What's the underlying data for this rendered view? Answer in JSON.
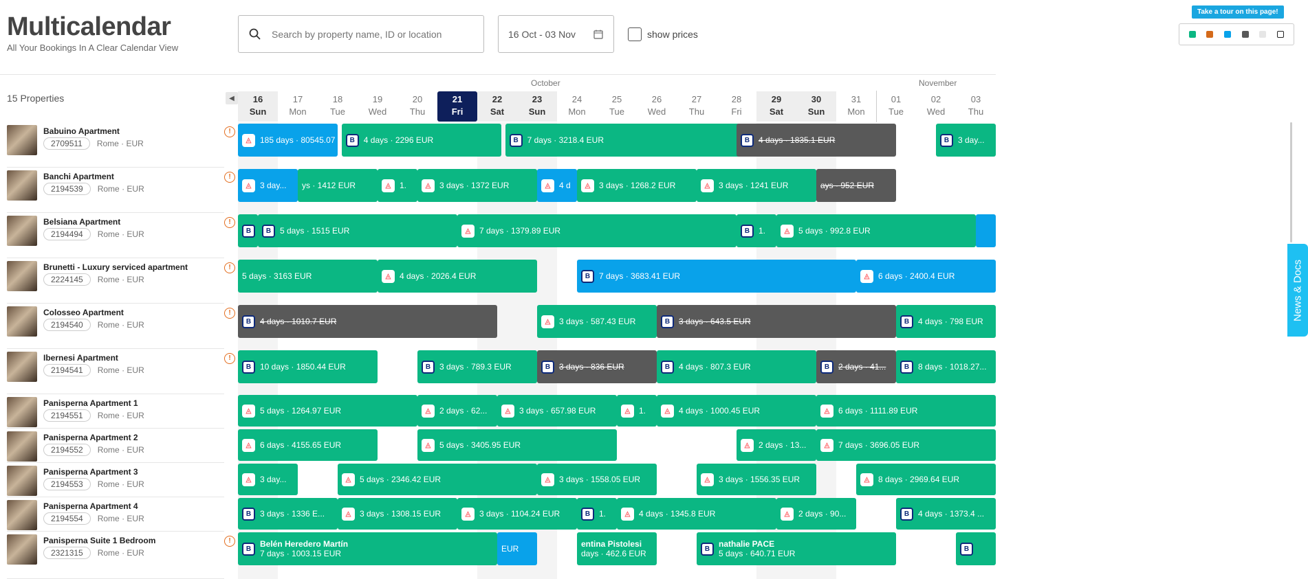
{
  "app": {
    "title": "Multicalendar",
    "subtitle": "All Your Bookings In A Clear Calendar View"
  },
  "search": {
    "placeholder": "Search by property name, ID or location"
  },
  "date_range": {
    "value": "16 Oct - 03 Nov"
  },
  "show_prices": {
    "label": "show prices",
    "checked": false
  },
  "tour": {
    "label": "Take a tour on this page!"
  },
  "legend": {
    "colors": [
      "#0bb783",
      "#d46a1a",
      "#09a2ea",
      "#595959",
      "#e6e6e6",
      "#ffffff"
    ]
  },
  "properties_count": "15 Properties",
  "months": [
    "October",
    "November"
  ],
  "days": [
    {
      "num": "16",
      "dow": "Sun"
    },
    {
      "num": "17",
      "dow": "Mon"
    },
    {
      "num": "18",
      "dow": "Tue"
    },
    {
      "num": "19",
      "dow": "Wed"
    },
    {
      "num": "20",
      "dow": "Thu"
    },
    {
      "num": "21",
      "dow": "Fri"
    },
    {
      "num": "22",
      "dow": "Sat"
    },
    {
      "num": "23",
      "dow": "Sun"
    },
    {
      "num": "24",
      "dow": "Mon"
    },
    {
      "num": "25",
      "dow": "Tue"
    },
    {
      "num": "26",
      "dow": "Wed"
    },
    {
      "num": "27",
      "dow": "Thu"
    },
    {
      "num": "28",
      "dow": "Fri"
    },
    {
      "num": "29",
      "dow": "Sat"
    },
    {
      "num": "30",
      "dow": "Sun"
    },
    {
      "num": "31",
      "dow": "Mon"
    },
    {
      "num": "01",
      "dow": "Tue"
    },
    {
      "num": "02",
      "dow": "Wed"
    },
    {
      "num": "03",
      "dow": "Thu"
    }
  ],
  "properties": [
    {
      "name": "Babuino Apartment",
      "id": "2709511",
      "city": "Rome",
      "currency": "EUR"
    },
    {
      "name": "Banchi Apartment",
      "id": "2194539",
      "city": "Rome",
      "currency": "EUR"
    },
    {
      "name": "Belsiana Apartment",
      "id": "2194494",
      "city": "Rome",
      "currency": "EUR"
    },
    {
      "name": "Brunetti - Luxury serviced apartment",
      "id": "2224145",
      "city": "Rome",
      "currency": "EUR"
    },
    {
      "name": "Colosseo Apartment",
      "id": "2194540",
      "city": "Rome",
      "currency": "EUR"
    },
    {
      "name": "Ibernesi Apartment",
      "id": "2194541",
      "city": "Rome",
      "currency": "EUR"
    },
    {
      "name": "Panisperna Apartment 1",
      "id": "2194551",
      "city": "Rome",
      "currency": "EUR"
    },
    {
      "name": "Panisperna Apartment 2",
      "id": "2194552",
      "city": "Rome",
      "currency": "EUR"
    },
    {
      "name": "Panisperna Apartment 3",
      "id": "2194553",
      "city": "Rome",
      "currency": "EUR"
    },
    {
      "name": "Panisperna Apartment 4",
      "id": "2194554",
      "city": "Rome",
      "currency": "EUR"
    },
    {
      "name": "Panisperna Suite 1 Bedroom",
      "id": "2321315",
      "city": "Rome",
      "currency": "EUR"
    }
  ],
  "bookings": [
    {
      "row": 0,
      "start": 0,
      "len": 2.5,
      "color": "blue",
      "src": "ab",
      "text": "185 days · 80545.07"
    },
    {
      "row": 0,
      "start": 2.6,
      "len": 4,
      "color": "green",
      "src": "bk",
      "text": "4 days · 2296 EUR"
    },
    {
      "row": 0,
      "start": 6.7,
      "len": 6,
      "color": "green",
      "src": "bk",
      "text": "7 days · 3218.4 EUR"
    },
    {
      "row": 0,
      "start": 12.5,
      "len": 4,
      "color": "gray",
      "src": "bk",
      "text": "4 days · 1835.1 EUR"
    },
    {
      "row": 0,
      "start": 17.5,
      "len": 1.5,
      "color": "green",
      "src": "bk",
      "text": "3 day..."
    },
    {
      "row": 1,
      "start": 0,
      "len": 1.5,
      "color": "blue",
      "src": "ab",
      "text": "3 day..."
    },
    {
      "row": 1,
      "start": 1.5,
      "len": 2,
      "color": "green",
      "src": "",
      "text": "ys · 1412 EUR"
    },
    {
      "row": 1,
      "start": 3.5,
      "len": 1,
      "color": "green",
      "src": "ab",
      "text": "1."
    },
    {
      "row": 1,
      "start": 4.5,
      "len": 3,
      "color": "green",
      "src": "ab",
      "text": "3 days · 1372 EUR"
    },
    {
      "row": 1,
      "start": 7.5,
      "len": 1,
      "color": "blue",
      "src": "ab",
      "text": "4 d"
    },
    {
      "row": 1,
      "start": 8.5,
      "len": 3,
      "color": "green",
      "src": "ab",
      "text": "3 days · 1268.2 EUR"
    },
    {
      "row": 1,
      "start": 11.5,
      "len": 3,
      "color": "green",
      "src": "ab",
      "text": "3 days · 1241 EUR"
    },
    {
      "row": 1,
      "start": 14.5,
      "len": 2,
      "color": "gray",
      "src": "",
      "text": "ays · 952 EUR"
    },
    {
      "row": 2,
      "start": 0,
      "len": 0.5,
      "color": "green",
      "src": "bk",
      "text": ""
    },
    {
      "row": 2,
      "start": 0.5,
      "len": 5,
      "color": "green",
      "src": "bk",
      "text": "5 days · 1515 EUR"
    },
    {
      "row": 2,
      "start": 5.5,
      "len": 7,
      "color": "green",
      "src": "ab",
      "text": "7 days · 1379.89 EUR"
    },
    {
      "row": 2,
      "start": 12.5,
      "len": 1,
      "color": "green",
      "src": "bk",
      "text": "1."
    },
    {
      "row": 2,
      "start": 13.5,
      "len": 5,
      "color": "green",
      "src": "ab",
      "text": "5 days · 992.8 EUR"
    },
    {
      "row": 2,
      "start": 18.5,
      "len": 0.5,
      "color": "blue",
      "src": "",
      "text": ""
    },
    {
      "row": 3,
      "start": 0,
      "len": 3.5,
      "color": "green",
      "src": "",
      "text": "5 days · 3163 EUR"
    },
    {
      "row": 3,
      "start": 3.5,
      "len": 4,
      "color": "green",
      "src": "ab",
      "text": "4 days · 2026.4 EUR"
    },
    {
      "row": 3,
      "start": 8.5,
      "len": 7,
      "color": "blue",
      "src": "bk",
      "text": "7 days · 3683.41 EUR"
    },
    {
      "row": 3,
      "start": 15.5,
      "len": 3.5,
      "color": "blue",
      "src": "ab",
      "text": "6 days · 2400.4 EUR"
    },
    {
      "row": 4,
      "start": 0,
      "len": 6.5,
      "color": "gray",
      "src": "bk",
      "text": "4 days · 1010.7 EUR"
    },
    {
      "row": 4,
      "start": 7.5,
      "len": 3,
      "color": "green",
      "src": "ab",
      "text": "3 days · 587.43 EUR"
    },
    {
      "row": 4,
      "start": 10.5,
      "len": 6,
      "color": "gray",
      "src": "bk",
      "text": "3 days · 643.5 EUR"
    },
    {
      "row": 4,
      "start": 16.5,
      "len": 2.5,
      "color": "green",
      "src": "bk",
      "text": "4 days · 798 EUR"
    },
    {
      "row": 5,
      "start": 0,
      "len": 3.5,
      "color": "green",
      "src": "bk",
      "text": "10 days · 1850.44 EUR"
    },
    {
      "row": 5,
      "start": 4.5,
      "len": 3,
      "color": "green",
      "src": "bk",
      "text": "3 days · 789.3 EUR"
    },
    {
      "row": 5,
      "start": 7.5,
      "len": 3,
      "color": "gray",
      "src": "bk",
      "text": "3 days · 836 EUR"
    },
    {
      "row": 5,
      "start": 10.5,
      "len": 4,
      "color": "green",
      "src": "bk",
      "text": "4 days · 807.3 EUR"
    },
    {
      "row": 5,
      "start": 14.5,
      "len": 2,
      "color": "gray",
      "src": "bk",
      "text": "2 days · 41..."
    },
    {
      "row": 5,
      "start": 16.5,
      "len": 2.5,
      "color": "green",
      "src": "bk",
      "text": "8 days · 1018.27..."
    },
    {
      "row": 6,
      "start": 0,
      "len": 4.5,
      "color": "green",
      "src": "ab",
      "text": "5 days · 1264.97 EUR"
    },
    {
      "row": 6,
      "start": 4.5,
      "len": 2,
      "color": "green",
      "src": "ab",
      "text": "2 days · 62..."
    },
    {
      "row": 6,
      "start": 6.5,
      "len": 3,
      "color": "green",
      "src": "ab",
      "text": "3 days · 657.98 EUR"
    },
    {
      "row": 6,
      "start": 9.5,
      "len": 1,
      "color": "green",
      "src": "ab",
      "text": "1."
    },
    {
      "row": 6,
      "start": 10.5,
      "len": 4,
      "color": "green",
      "src": "ab",
      "text": "4 days · 1000.45 EUR"
    },
    {
      "row": 6,
      "start": 14.5,
      "len": 4.5,
      "color": "green",
      "src": "ab",
      "text": "6 days · 1111.89 EUR"
    },
    {
      "row": 7,
      "start": 0,
      "len": 3.5,
      "color": "green",
      "src": "ab",
      "text": "6 days · 4155.65 EUR"
    },
    {
      "row": 7,
      "start": 4.5,
      "len": 5,
      "color": "green",
      "src": "ab",
      "text": "5 days · 3405.95 EUR"
    },
    {
      "row": 7,
      "start": 12.5,
      "len": 2,
      "color": "green",
      "src": "ab",
      "text": "2 days · 13..."
    },
    {
      "row": 7,
      "start": 14.5,
      "len": 4.5,
      "color": "green",
      "src": "ab",
      "text": "7 days · 3696.05 EUR"
    },
    {
      "row": 8,
      "start": 0,
      "len": 1.5,
      "color": "green",
      "src": "ab",
      "text": "3 day..."
    },
    {
      "row": 8,
      "start": 2.5,
      "len": 5,
      "color": "green",
      "src": "ab",
      "text": "5 days · 2346.42 EUR"
    },
    {
      "row": 8,
      "start": 7.5,
      "len": 3,
      "color": "green",
      "src": "ab",
      "text": "3 days · 1558.05 EUR"
    },
    {
      "row": 8,
      "start": 11.5,
      "len": 3,
      "color": "green",
      "src": "ab",
      "text": "3 days · 1556.35 EUR"
    },
    {
      "row": 8,
      "start": 15.5,
      "len": 3.5,
      "color": "green",
      "src": "ab",
      "text": "8 days · 2969.64 EUR"
    },
    {
      "row": 9,
      "start": 0,
      "len": 2.5,
      "color": "green",
      "src": "bk",
      "text": "3 days · 1336 E..."
    },
    {
      "row": 9,
      "start": 2.5,
      "len": 3,
      "color": "green",
      "src": "ab",
      "text": "3 days · 1308.15 EUR"
    },
    {
      "row": 9,
      "start": 5.5,
      "len": 3,
      "color": "green",
      "src": "ab",
      "text": "3 days · 1104.24 EUR"
    },
    {
      "row": 9,
      "start": 8.5,
      "len": 1,
      "color": "green",
      "src": "bk",
      "text": "1."
    },
    {
      "row": 9,
      "start": 9.5,
      "len": 4,
      "color": "green",
      "src": "ab",
      "text": "4 days · 1345.8 EUR"
    },
    {
      "row": 9,
      "start": 13.5,
      "len": 2,
      "color": "green",
      "src": "ab",
      "text": "2 days · 90..."
    },
    {
      "row": 9,
      "start": 16.5,
      "len": 2.5,
      "color": "green",
      "src": "bk",
      "text": "4 days · 1373.4 ..."
    },
    {
      "row": 10,
      "start": 0,
      "len": 6.5,
      "color": "green",
      "src": "bk",
      "text": "7 days · 1003.15 EUR",
      "guest": "Belén Heredero Martín"
    },
    {
      "row": 10,
      "start": 6.5,
      "len": 1,
      "color": "blue",
      "src": "",
      "text": "EUR"
    },
    {
      "row": 10,
      "start": 8.5,
      "len": 2,
      "color": "green",
      "src": "",
      "text": "days · 462.6 EUR",
      "guest": "entina Pistolesi"
    },
    {
      "row": 10,
      "start": 11.5,
      "len": 5,
      "color": "green",
      "src": "bk",
      "text": "5 days · 640.71 EUR",
      "guest": "nathalie PACE"
    },
    {
      "row": 10,
      "start": 18,
      "len": 1,
      "color": "green",
      "src": "bk",
      "text": ""
    }
  ],
  "news": {
    "label": "News & Docs"
  }
}
